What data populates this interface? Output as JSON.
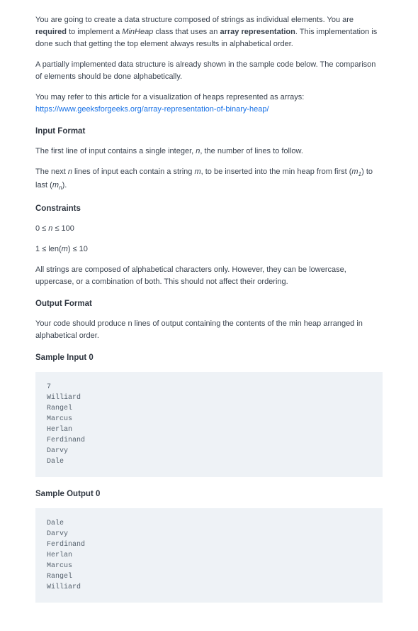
{
  "intro": {
    "p1_a": "You are going to create a data structure composed of strings as individual elements. You are ",
    "p1_b_bold": "required",
    "p1_c": " to implement a ",
    "p1_d_italic": "MinHeap",
    "p1_e": " class that uses an ",
    "p1_f_bold": "array representation",
    "p1_g": ". This implementation is done such that getting the top element always results in alphabetical order.",
    "p2": "A partially implemented data structure is already shown in the sample code below. The comparison of elements should be done alphabetically.",
    "p3": "You may refer to this article for a visualization of heaps represented as arrays:",
    "link_text": "https://www.geeksforgeeks.org/array-representation-of-binary-heap/",
    "link_href": "https://www.geeksforgeeks.org/array-representation-of-binary-heap/"
  },
  "sections": {
    "input_format": "Input Format",
    "constraints": "Constraints",
    "output_format": "Output Format",
    "sample_input_0": "Sample Input 0",
    "sample_output_0": "Sample Output 0"
  },
  "input_format": {
    "p1_a": "The first line of input contains a single integer, ",
    "p1_n": "n",
    "p1_b": ", the number of lines to follow.",
    "p2_a": "The next ",
    "p2_n1": "n",
    "p2_b": " lines of input each contain a string ",
    "p2_m": "m",
    "p2_c": ", to be inserted into the min heap from first (",
    "p2_m1_base": "m",
    "p2_m1_sub": "1",
    "p2_d": ") to last (",
    "p2_mn_base": "m",
    "p2_mn_sub": "n",
    "p2_e": ")."
  },
  "constraints": {
    "c1_a": "0 ≤ ",
    "c1_n": "n",
    "c1_b": " ≤ 100",
    "c2_a": "1 ≤ len(",
    "c2_m": "m",
    "c2_b": ") ≤ 10",
    "c3": "All strings are composed of alphabetical characters only. However, they can be lowercase, uppercase, or a combination of both. This should not affect their ordering."
  },
  "output_format": {
    "p1": "Your code should produce n lines of output containing the contents of the min heap arranged in alphabetical order."
  },
  "sample_input_0": "7\nWilliard\nRangel\nMarcus\nHerlan\nFerdinand\nDarvy\nDale",
  "sample_output_0": "Dale\nDarvy\nFerdinand\nHerlan\nMarcus\nRangel\nWilliard"
}
